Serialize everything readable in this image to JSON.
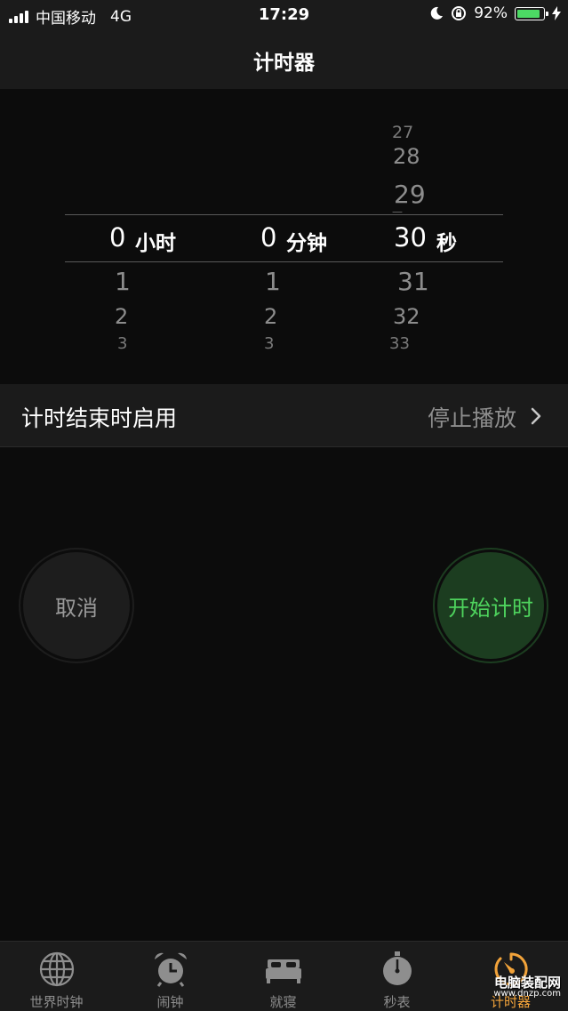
{
  "status_bar": {
    "carrier": "中国移动",
    "network": "4G",
    "time": "17:29",
    "battery": "92%",
    "battery_level": 0.92,
    "battery_color": "#4cd964"
  },
  "header": {
    "title": "计时器"
  },
  "picker": {
    "hours": {
      "above": [],
      "selected": "0",
      "below": [
        "1",
        "2",
        "3"
      ],
      "unit": "小时"
    },
    "minutes": {
      "above": [],
      "selected": "0",
      "below": [
        "1",
        "2",
        "3"
      ],
      "unit": "分钟"
    },
    "seconds": {
      "above": [
        "27",
        "28",
        "29"
      ],
      "selected": "30",
      "below": [
        "31",
        "32",
        "33"
      ],
      "unit": "秒"
    }
  },
  "on_end": {
    "label": "计时结束时启用",
    "value": "停止播放"
  },
  "buttons": {
    "cancel": "取消",
    "start": "开始计时"
  },
  "tabs": [
    {
      "label": "世界时钟",
      "icon": "globe-icon"
    },
    {
      "label": "闹钟",
      "icon": "alarm-clock-icon"
    },
    {
      "label": "就寝",
      "icon": "bed-icon"
    },
    {
      "label": "秒表",
      "icon": "stopwatch-icon"
    },
    {
      "label": "计时器",
      "icon": "timer-icon",
      "active": true
    }
  ],
  "colors": {
    "accent": "#f2a33a",
    "start_text": "#4ed35d",
    "start_bg": "#1c3d20"
  },
  "watermark": {
    "line1": "电脑装配网",
    "line2": "www.dnzp.com"
  }
}
